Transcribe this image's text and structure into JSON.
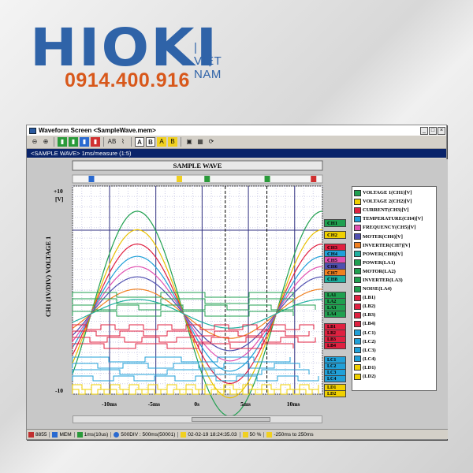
{
  "brand": {
    "name": "HIOKI",
    "sub": "| VIỆT NAM",
    "phone": "0914.400.916"
  },
  "window": {
    "title": "Waveform Screen <SampleWave.mem>",
    "subtitle": "<SAMPLE WAVE> 1ms/measure (1:5)",
    "buttons": {
      "minimize": "_",
      "maximize": "□",
      "close": "×"
    }
  },
  "toolbar": {
    "items": [
      {
        "name": "zoom-out-icon",
        "glyph": "⊖",
        "style": ""
      },
      {
        "name": "zoom-in-icon",
        "glyph": "⊕",
        "style": ""
      },
      {
        "name": "channel-a-icon",
        "glyph": "▮",
        "style": "g"
      },
      {
        "name": "channel-b-icon",
        "glyph": "▮",
        "style": "g"
      },
      {
        "name": "cursor-b-icon",
        "glyph": "▮",
        "style": "b"
      },
      {
        "name": "cursor-r-icon",
        "glyph": "▮",
        "style": "r"
      },
      {
        "name": "ab-icon",
        "glyph": "AB",
        "style": ""
      },
      {
        "name": "trace-icon",
        "glyph": "⌇",
        "style": ""
      },
      {
        "name": "a-box-icon",
        "glyph": "A",
        "style": "box"
      },
      {
        "name": "b-box-icon",
        "glyph": "B",
        "style": "box"
      },
      {
        "name": "a-marker-icon",
        "glyph": "A",
        "style": "y"
      },
      {
        "name": "b-marker-icon",
        "glyph": "B",
        "style": "y"
      },
      {
        "name": "settings-icon",
        "glyph": "▣",
        "style": ""
      },
      {
        "name": "grid-icon",
        "glyph": "▦",
        "style": ""
      },
      {
        "name": "refresh-icon",
        "glyph": "⟳",
        "style": ""
      }
    ]
  },
  "plot": {
    "title": "SAMPLE WAVE",
    "ylabel": "CH1 (1V/DIV)  VOLTAGE 1",
    "ytop": "+10",
    "yunit": "[V]",
    "ybottom": "-10",
    "cursor_markers": [
      "B",
      "T",
      "A",
      "B",
      "R"
    ]
  },
  "chart_data": {
    "type": "line",
    "title": "SAMPLE WAVE",
    "xlabel": "",
    "ylabel": "CH1 (1V/DIV) VOLTAGE 1",
    "x_ticks": [
      "-10ms",
      "-5ms",
      "0s",
      "5ms",
      "10ms"
    ],
    "xlim": [
      -14,
      13
    ],
    "ylim": [
      -10,
      10
    ],
    "series": [
      {
        "name": "VOLTAGE 1(CH1)[V]",
        "color": "#20a050",
        "amplitude": 10
      },
      {
        "name": "VOLTAGE 2(CH2)[V]",
        "color": "#e8c000",
        "amplitude": 8.2
      },
      {
        "name": "CURRENT(CH3)[V]",
        "color": "#e02040",
        "amplitude": 6.8
      },
      {
        "name": "TEMPERATURE(CH4)[V]",
        "color": "#20a0d8",
        "amplitude": 5.6
      },
      {
        "name": "FREQUENCY(CH5)[V]",
        "color": "#e050b0",
        "amplitude": 4.6
      },
      {
        "name": "MOTER(CH6)[V]",
        "color": "#5050b0",
        "amplitude": 3.6
      },
      {
        "name": "INVERTER(CH7)[V]",
        "color": "#f08020",
        "amplitude": 2.4
      },
      {
        "name": "POWER(CH8)[V]",
        "color": "#20b0a0",
        "amplitude": 1.4
      }
    ]
  },
  "channel_tags": {
    "analog": [
      {
        "label": "CH1",
        "color": "#20a050"
      },
      {
        "label": "CH2",
        "color": "#f0d000"
      },
      {
        "label": "CH3",
        "color": "#e02040"
      },
      {
        "label": "CH4",
        "color": "#20a0d8"
      },
      {
        "label": "CH5",
        "color": "#e050b0"
      },
      {
        "label": "CH6",
        "color": "#5050b0"
      },
      {
        "label": "CH7",
        "color": "#f08020"
      },
      {
        "label": "CH8",
        "color": "#20b0a0"
      }
    ],
    "logic": [
      {
        "label": "LA1",
        "color": "#20a050"
      },
      {
        "label": "LA2",
        "color": "#20a050"
      },
      {
        "label": "LA3",
        "color": "#20a050"
      },
      {
        "label": "LA4",
        "color": "#20a050"
      },
      {
        "label": "LB1",
        "color": "#e02040"
      },
      {
        "label": "LB2",
        "color": "#e02040"
      },
      {
        "label": "LB3",
        "color": "#e02040"
      },
      {
        "label": "LB4",
        "color": "#e02040"
      },
      {
        "label": "LC1",
        "color": "#20a0d8"
      },
      {
        "label": "LC2",
        "color": "#20a0d8"
      },
      {
        "label": "LC3",
        "color": "#20a0d8"
      },
      {
        "label": "LC4",
        "color": "#20a0d8"
      },
      {
        "label": "LD1",
        "color": "#f0d000"
      },
      {
        "label": "LD2",
        "color": "#f0d000"
      }
    ]
  },
  "legend": [
    {
      "label": "VOLTAGE 1(CH1)[V]",
      "color": "#20a050"
    },
    {
      "label": "VOLTAGE 2(CH2)[V]",
      "color": "#f0d000"
    },
    {
      "label": "CURRENT(CH3)[V]",
      "color": "#e02040"
    },
    {
      "label": "TEMPERATURE(CH4)[V]",
      "color": "#20a0d8"
    },
    {
      "label": "FREQUENCY(CH5)[V]",
      "color": "#e050b0"
    },
    {
      "label": "MOTER(CH6)[V]",
      "color": "#5050b0"
    },
    {
      "label": "INVERTER(CH7)[V]",
      "color": "#f08020"
    },
    {
      "label": "POWER(CH8)[V]",
      "color": "#20b0a0"
    },
    {
      "label": "POWER(LA1)",
      "color": "#20a050"
    },
    {
      "label": "MOTOR(LA2)",
      "color": "#20a050"
    },
    {
      "label": "INVERTER(LA3)",
      "color": "#20a050"
    },
    {
      "label": "NOISE(LA4)",
      "color": "#20a050"
    },
    {
      "label": "(LB1)",
      "color": "#e02040"
    },
    {
      "label": "(LB2)",
      "color": "#e02040"
    },
    {
      "label": "(LB3)",
      "color": "#e02040"
    },
    {
      "label": "(LB4)",
      "color": "#e02040"
    },
    {
      "label": "(LC1)",
      "color": "#20a0d8"
    },
    {
      "label": "(LC2)",
      "color": "#20a0d8"
    },
    {
      "label": "(LC3)",
      "color": "#20a0d8"
    },
    {
      "label": "(LC4)",
      "color": "#20a0d8"
    },
    {
      "label": "(LD1)",
      "color": "#f0d000"
    },
    {
      "label": "(LD2)",
      "color": "#f0d000"
    }
  ],
  "status": {
    "model": "8855",
    "mode": "MEM",
    "timebase": "1ms(10us)",
    "shot": "500DIV : 500ms(50001)",
    "trigger_time": "02-02-19 18:24:35.03",
    "zoom": "50 %",
    "range": "-250ms to 250ms"
  }
}
